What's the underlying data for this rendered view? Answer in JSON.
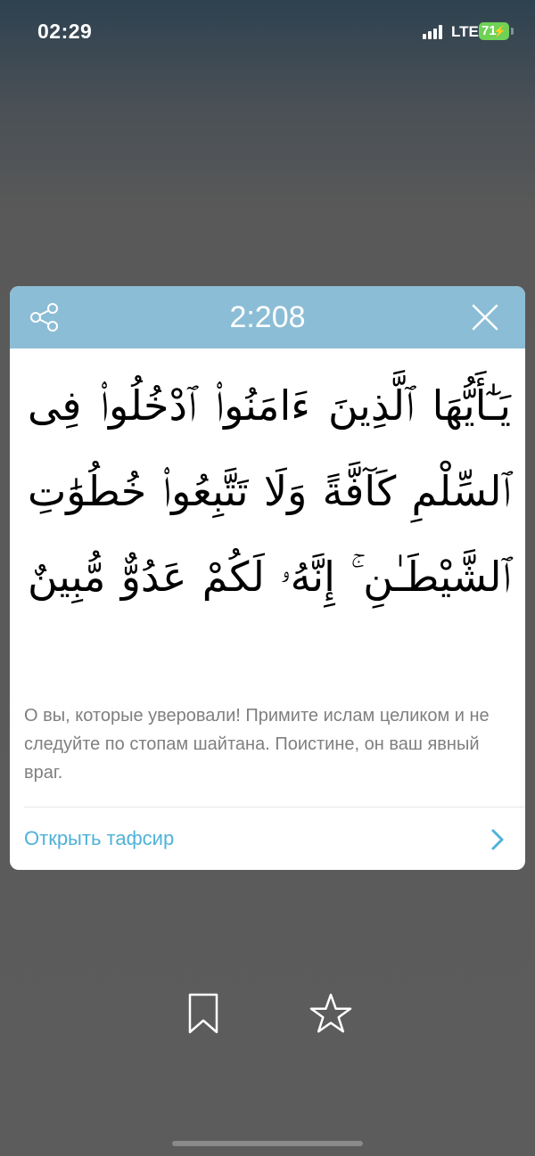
{
  "status_bar": {
    "time": "02:29",
    "network": "LTE",
    "battery": "71"
  },
  "verse_card": {
    "reference": "2:208",
    "arabic_text": "يَـٰٓأَيُّهَا ٱلَّذِينَ ءَامَنُوا۟ ٱدْخُلُوا۟ فِى ٱلسِّلْمِ كَآفَّةً وَلَا تَتَّبِعُوا۟ خُطُوَٰتِ ٱلشَّيْطَـٰنِ ۚ إِنَّهُۥ لَكُمْ عَدُوٌّ مُّبِينٌ",
    "translation": "О вы, которые уверовали! Примите ислам целиком и не следуйте по стопам шайтана. Поистине, он ваш явный враг.",
    "tafsir_link": "Открыть тафсир",
    "header_color": "#8cbdd6",
    "link_color": "#4fb2d8"
  },
  "icons": {
    "share": "share-icon",
    "close": "close-icon",
    "chevron": "chevron-right-icon",
    "bookmark": "bookmark-icon",
    "favorite": "star-icon"
  }
}
